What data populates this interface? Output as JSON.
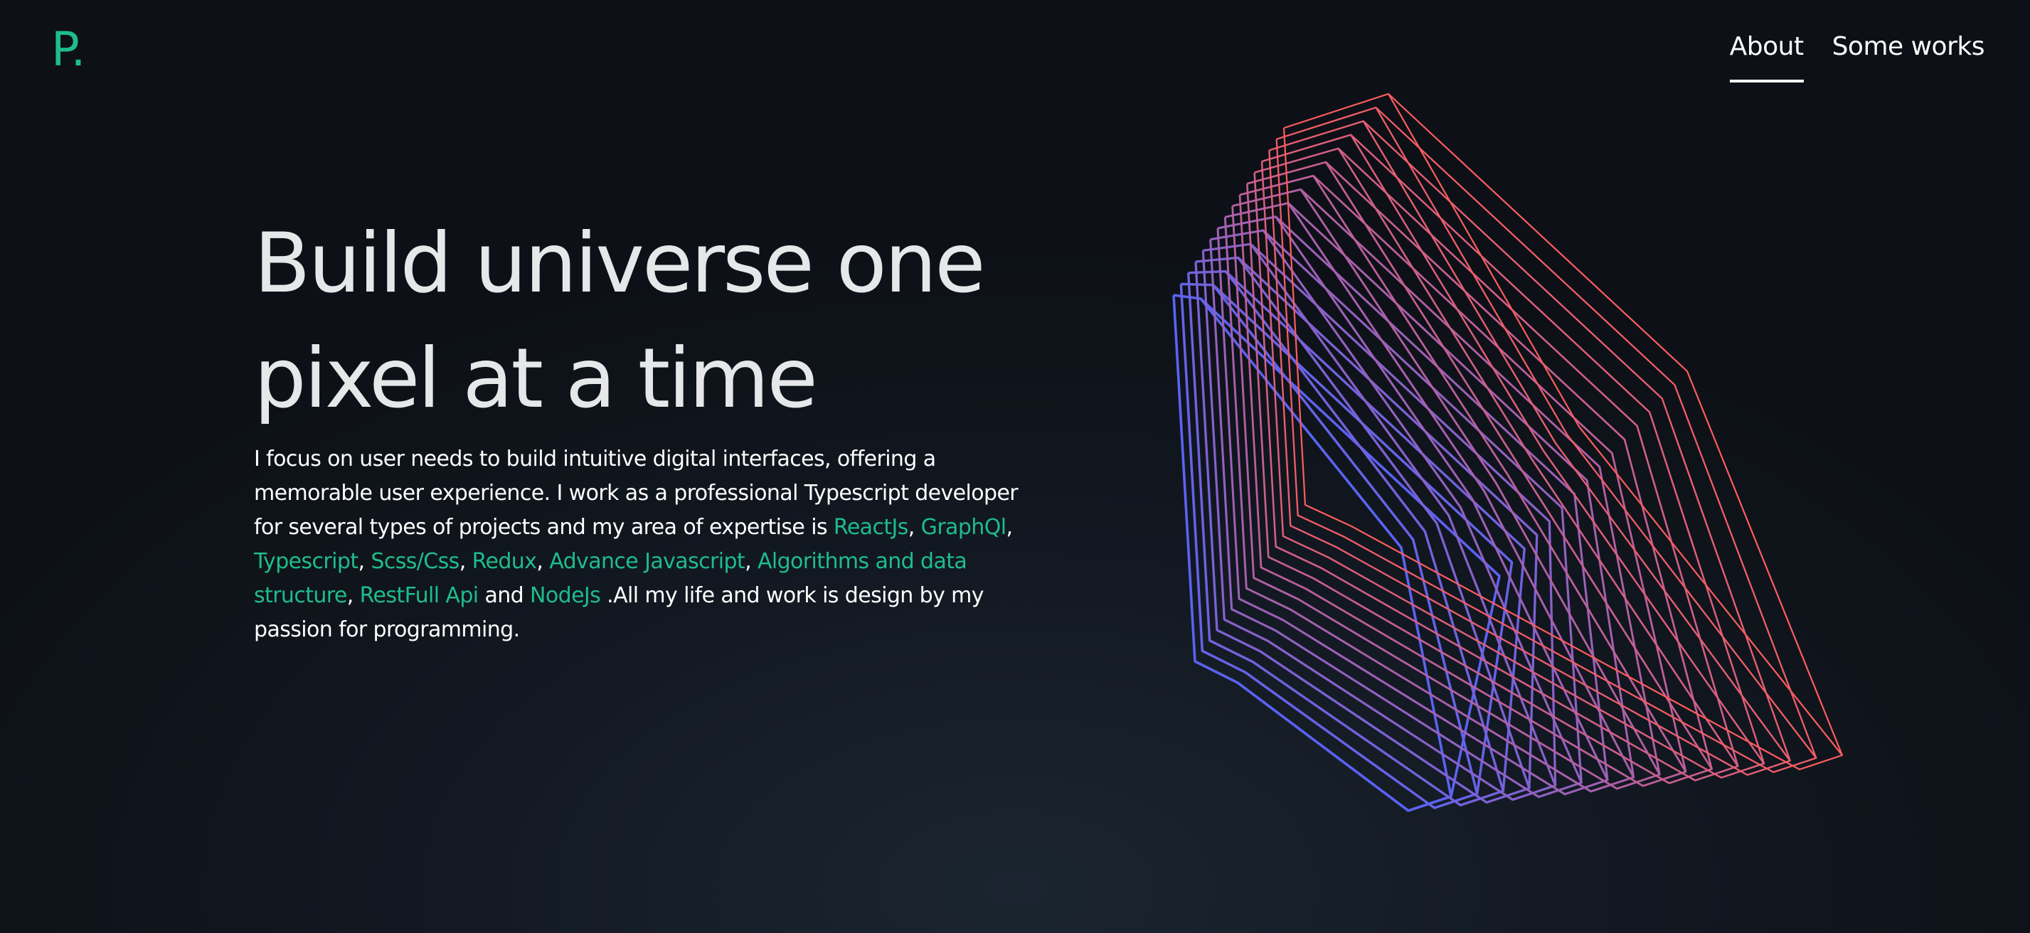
{
  "logo": {
    "text": "P."
  },
  "nav": {
    "items": [
      {
        "label": "About",
        "active": true
      },
      {
        "label": "Some works",
        "active": false
      }
    ]
  },
  "hero": {
    "title_line1": "Build universe one",
    "title_line2": "pixel at a time",
    "desc_part1": "I focus on user needs to build intuitive digital interfaces, offering a memorable user experience. I work as a professional Typescript developer for several types of projects and my area of expertise is ",
    "skills": [
      "ReactJs",
      "GraphQl",
      "Typescript",
      "Scss/Css",
      "Redux",
      "Advance Javascript",
      "Algorithms and data structure",
      "RestFull Api"
    ],
    "sep": ", ",
    "and": " and ",
    "last_skill": "NodeJs",
    "desc_end": " .All my life and work is design by my passion for programming."
  },
  "colors": {
    "accent": "#1fbc8c",
    "gradient_start": "#5b63f2",
    "gradient_end": "#ff5d5d"
  }
}
